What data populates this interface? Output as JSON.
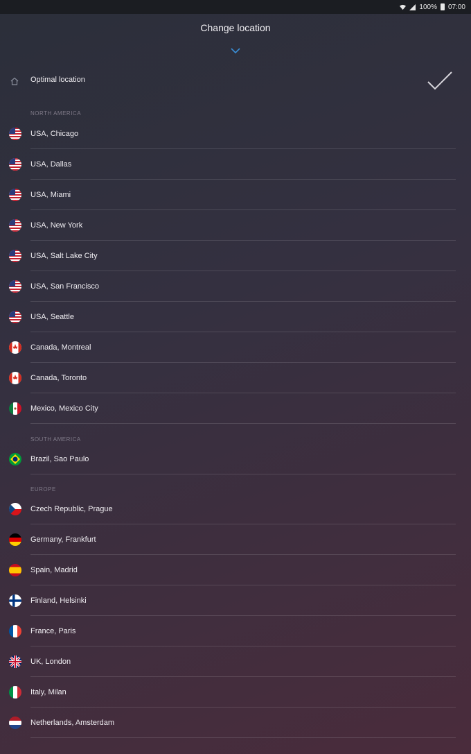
{
  "status_bar": {
    "battery": "100%",
    "time": "07:00"
  },
  "header": {
    "title": "Change location"
  },
  "optimal": {
    "label": "Optimal location"
  },
  "sections": {
    "north_america": "NORTH AMERICA",
    "south_america": "SOUTH AMERICA",
    "europe": "EUROPE"
  },
  "locations": [
    {
      "label": "USA, Chicago",
      "flag": "us"
    },
    {
      "label": "USA, Dallas",
      "flag": "us"
    },
    {
      "label": "USA, Miami",
      "flag": "us"
    },
    {
      "label": "USA, New York",
      "flag": "us"
    },
    {
      "label": "USA, Salt Lake City",
      "flag": "us"
    },
    {
      "label": "USA, San Francisco",
      "flag": "us"
    },
    {
      "label": "USA, Seattle",
      "flag": "us"
    },
    {
      "label": "Canada, Montreal",
      "flag": "ca"
    },
    {
      "label": "Canada, Toronto",
      "flag": "ca"
    },
    {
      "label": "Mexico, Mexico City",
      "flag": "mx"
    },
    {
      "label": "Brazil, Sao Paulo",
      "flag": "br"
    },
    {
      "label": "Czech Republic, Prague",
      "flag": "cz"
    },
    {
      "label": "Germany, Frankfurt",
      "flag": "de"
    },
    {
      "label": "Spain, Madrid",
      "flag": "es"
    },
    {
      "label": "Finland, Helsinki",
      "flag": "fi"
    },
    {
      "label": "France, Paris",
      "flag": "fr"
    },
    {
      "label": "UK, London",
      "flag": "gb"
    },
    {
      "label": "Italy, Milan",
      "flag": "it"
    },
    {
      "label": "Netherlands, Amsterdam",
      "flag": "nl"
    }
  ]
}
